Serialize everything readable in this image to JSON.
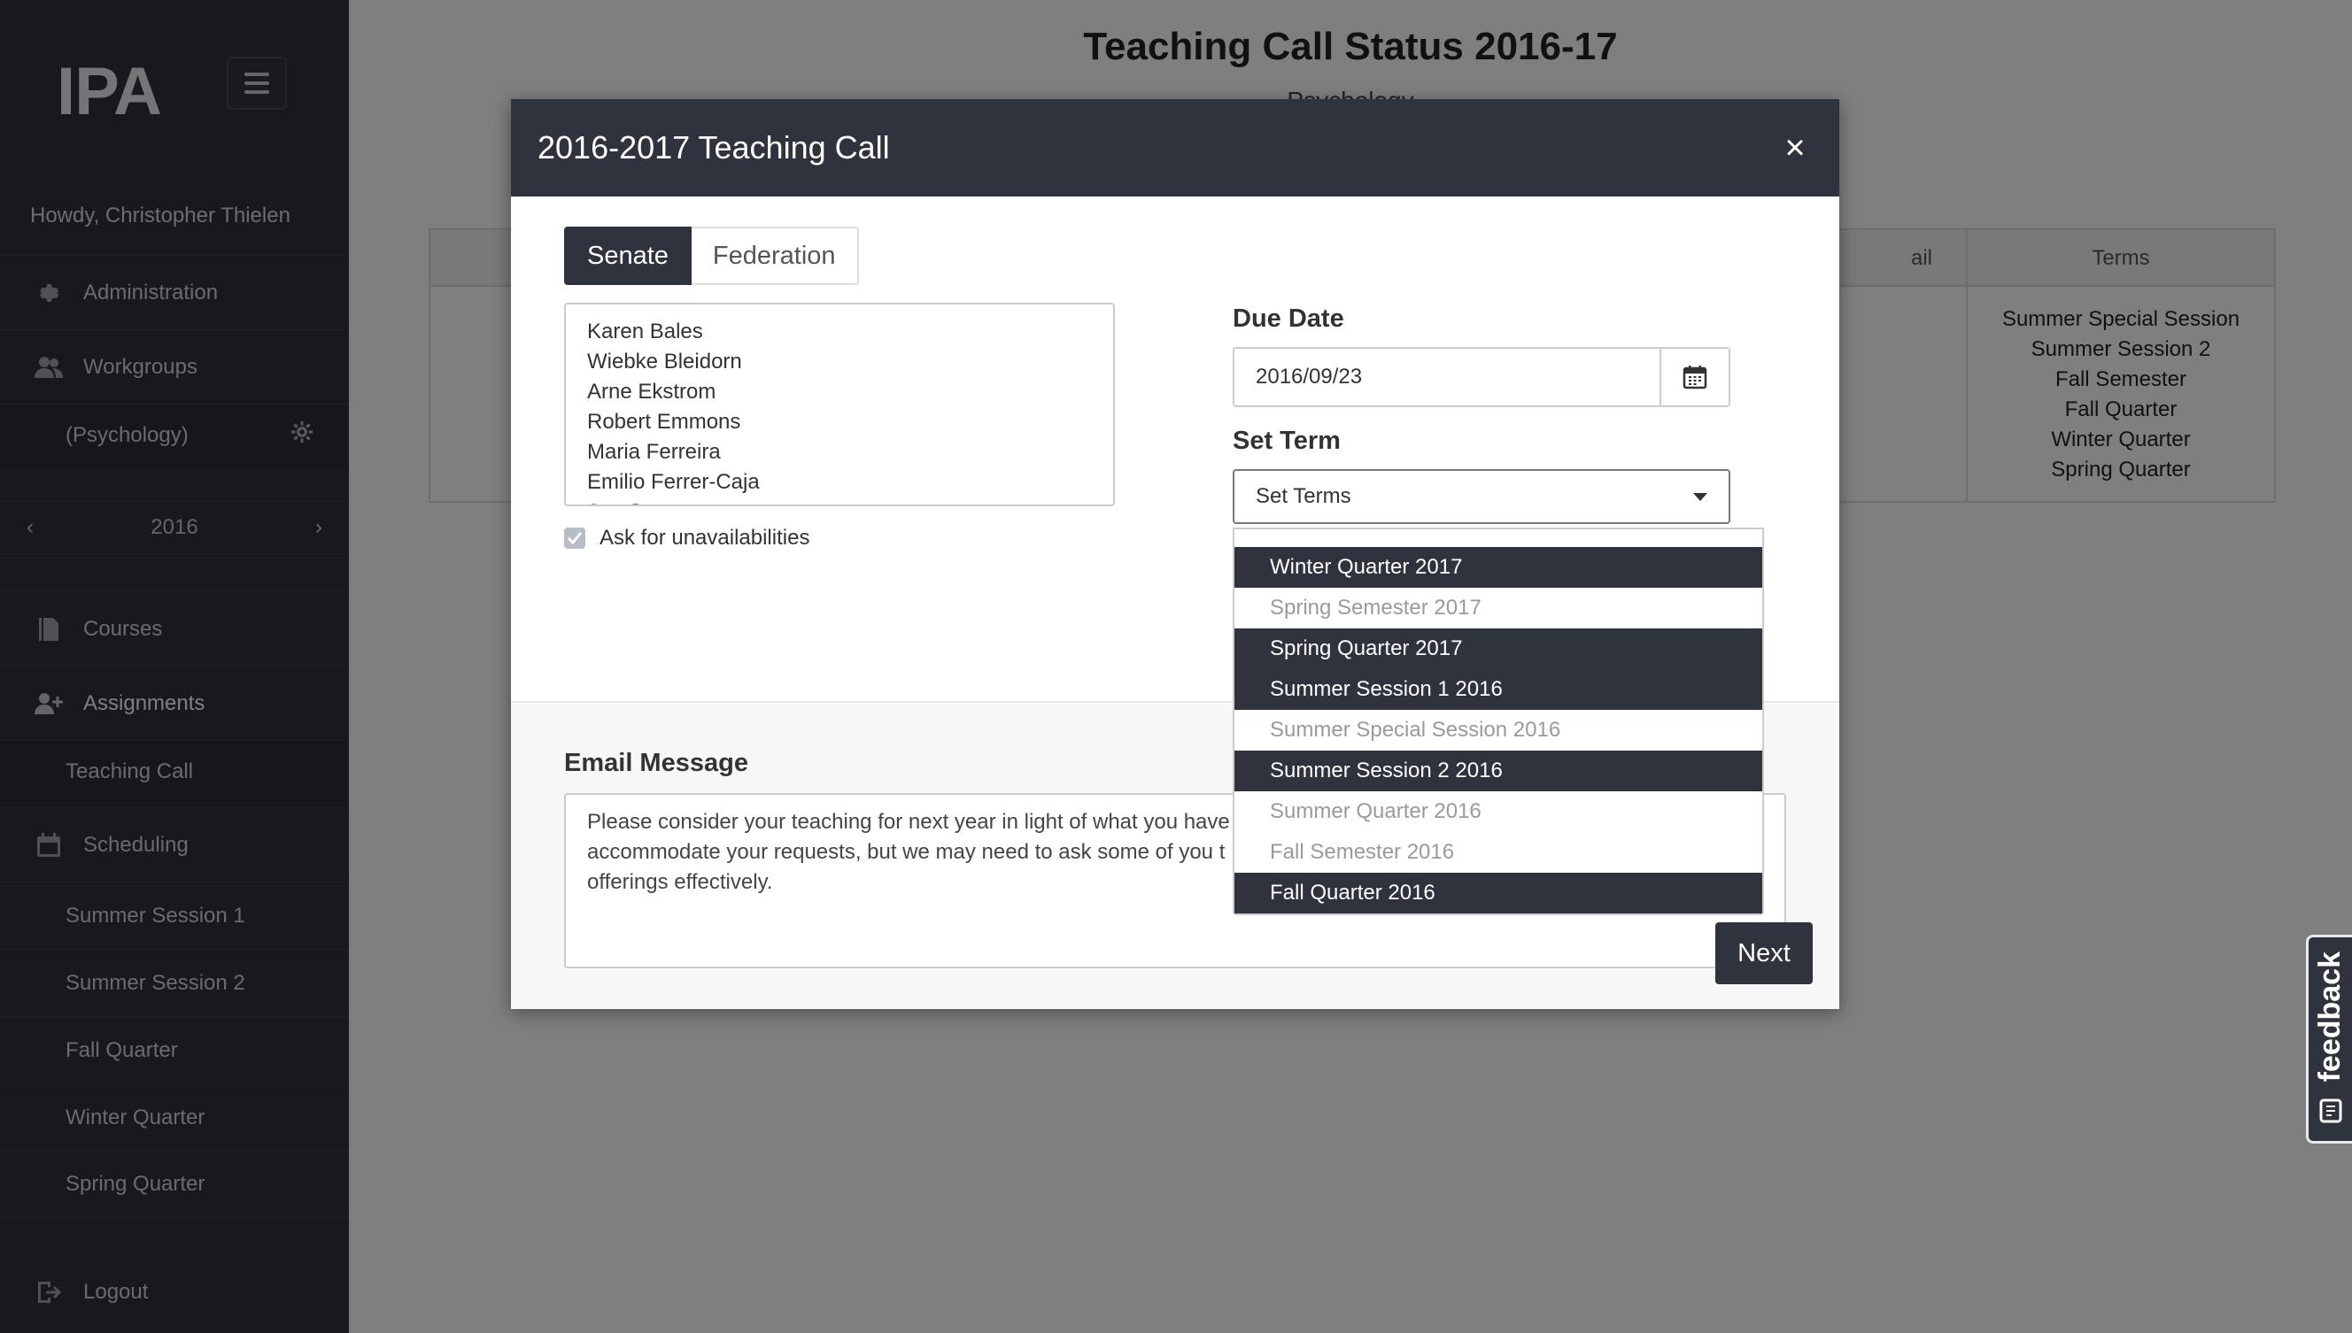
{
  "app": {
    "logo": "IPA",
    "greeting": "Howdy, Christopher Thielen"
  },
  "sidebar": {
    "administration": "Administration",
    "workgroups": "Workgroups",
    "workgroup_name": "(Psychology)",
    "year": "2016",
    "courses": "Courses",
    "assignments": "Assignments",
    "teaching_call": "Teaching Call",
    "scheduling": "Scheduling",
    "schedule_items": [
      "Summer Session 1",
      "Summer Session 2",
      "Fall Quarter",
      "Winter Quarter",
      "Spring Quarter"
    ],
    "logout": "Logout"
  },
  "background": {
    "title": "Teaching Call Status 2016-17",
    "subtitle": "Psychology",
    "terms_header": "Terms",
    "partial_header": "ail",
    "terms": [
      "Summer Special Session",
      "Summer Session 2",
      "Fall Semester",
      "Fall Quarter",
      "Winter Quarter",
      "Spring Quarter"
    ]
  },
  "modal": {
    "title": "2016-2017 Teaching Call",
    "close": "×",
    "tabs": [
      "Senate",
      "Federation"
    ],
    "instructors": [
      "Karen Bales",
      "Wiebke Bleidorn",
      "Arne Ekstrom",
      "Robert Emmons",
      "Maria Ferreira",
      "Emilio Ferrer-Caja",
      "Jan Gregory"
    ],
    "ask_unavailabilities": "Ask for unavailabilities",
    "due_date_label": "Due Date",
    "due_date_value": "2016/09/23",
    "set_term_label": "Set Term",
    "set_terms_placeholder": "Set Terms",
    "terms": [
      {
        "label": "Winter Quarter 2017",
        "selected": true
      },
      {
        "label": "Spring Semester 2017",
        "selected": false
      },
      {
        "label": "Spring Quarter 2017",
        "selected": true
      },
      {
        "label": "Summer Session 1 2016",
        "selected": true
      },
      {
        "label": "Summer Special Session 2016",
        "selected": false
      },
      {
        "label": "Summer Session 2 2016",
        "selected": true
      },
      {
        "label": "Summer Quarter 2016",
        "selected": false
      },
      {
        "label": "Fall Semester 2016",
        "selected": false
      },
      {
        "label": "Fall Quarter 2016",
        "selected": true
      }
    ],
    "email_label": "Email Message",
    "email_lines": [
      "Please consider your teaching for next year in light of what you have",
      "accommodate your requests, but we may need to ask some of you t",
      "offerings effectively."
    ],
    "next": "Next"
  },
  "feedback": "feedback",
  "colors": {
    "dark": "#2f333d",
    "overlay": "rgba(0,0,0,0.5)"
  }
}
